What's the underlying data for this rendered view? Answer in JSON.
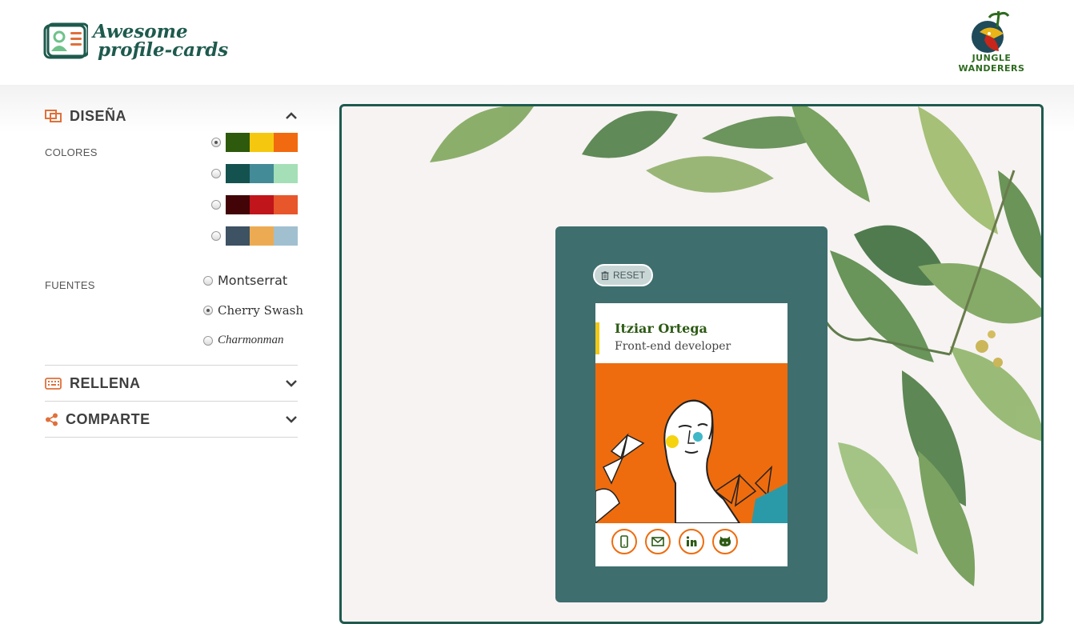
{
  "header": {
    "logo_line1": "Awesome",
    "logo_line2": "profile-cards",
    "partner_logo_text": "JUNGLE WANDERERS"
  },
  "sidebar": {
    "design": {
      "title": "DISEÑA",
      "colors_label": "COLORES",
      "palettes": [
        {
          "checked": true,
          "colors": [
            "#2d5a0c",
            "#f5c80f",
            "#f26a0f"
          ]
        },
        {
          "checked": false,
          "colors": [
            "#14524f",
            "#438b97",
            "#a4dfb7"
          ]
        },
        {
          "checked": false,
          "colors": [
            "#420407",
            "#c0151b",
            "#e8562b"
          ]
        },
        {
          "checked": false,
          "colors": [
            "#3d5263",
            "#ecab52",
            "#a0c0d0"
          ]
        }
      ],
      "fonts_label": "FUENTES",
      "fonts": [
        {
          "label": "Montserrat",
          "checked": false
        },
        {
          "label": "Cherry Swash",
          "checked": true
        },
        {
          "label": "Charmonman",
          "checked": false
        }
      ]
    },
    "fill": {
      "title": "RELLENA"
    },
    "share": {
      "title": "COMPARTE"
    }
  },
  "preview": {
    "reset_label": "RESET",
    "card": {
      "name": "Itziar Ortega",
      "job": "Front-end developer"
    },
    "links": [
      "phone-icon",
      "mail-icon",
      "linkedin-icon",
      "github-icon"
    ]
  },
  "colors": {
    "brand": "#1e5a4e",
    "accent": "#e0703a",
    "card_primary": "#2d5a14",
    "card_secondary": "#f0c818",
    "card_tertiary": "#ee6c0e"
  }
}
